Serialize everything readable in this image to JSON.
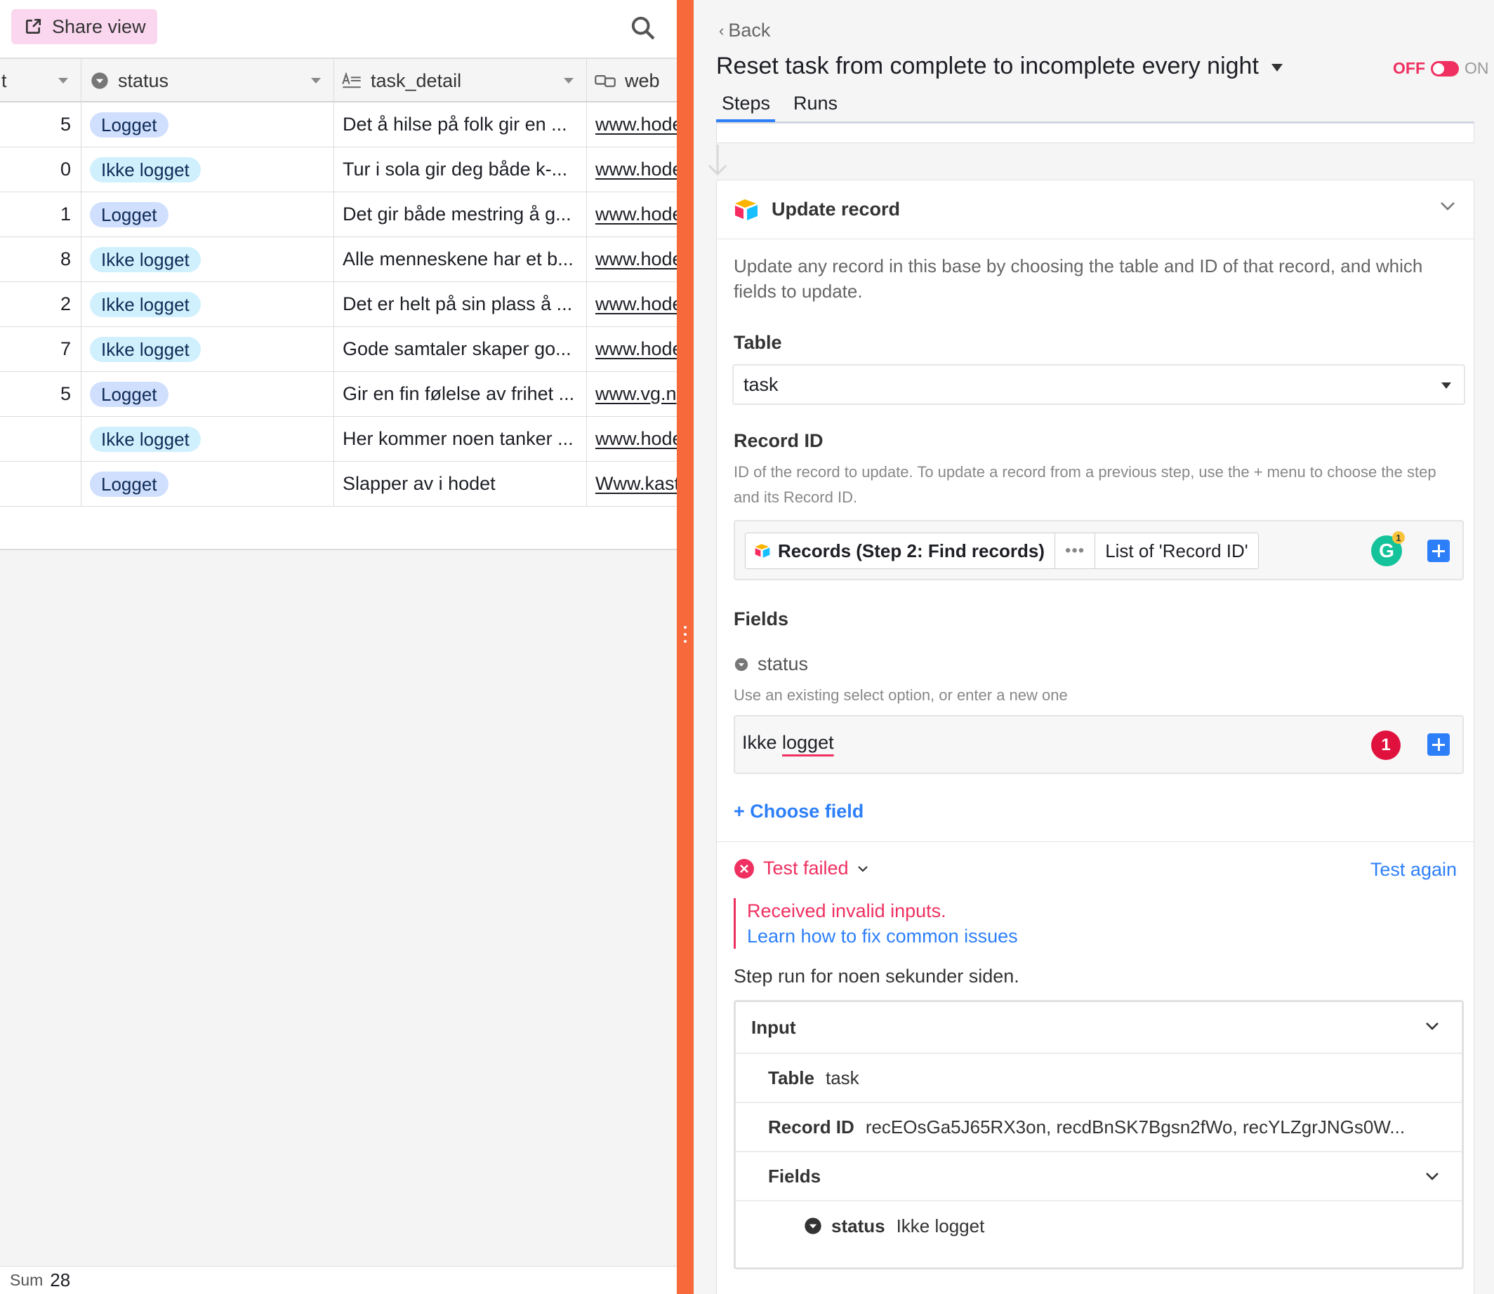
{
  "grid": {
    "share_view_label": "Share view",
    "columns": {
      "num_partial": "t",
      "status": "status",
      "task_detail": "task_detail",
      "web": "web"
    },
    "rows": [
      {
        "num": "5",
        "status": "Logget",
        "status_kind": "logget",
        "detail": "Det å hilse på folk gir en ...",
        "web": "www.hode"
      },
      {
        "num": "0",
        "status": "Ikke logget",
        "status_kind": "ikke",
        "detail": "Tur i sola gir deg både k-...",
        "web": "www.hode"
      },
      {
        "num": "1",
        "status": "Logget",
        "status_kind": "logget",
        "detail": "Det gir både mestring å g...",
        "web": "www.hode"
      },
      {
        "num": "8",
        "status": "Ikke logget",
        "status_kind": "ikke",
        "detail": "Alle menneskene har et b...",
        "web": "www.hode"
      },
      {
        "num": "2",
        "status": "Ikke logget",
        "status_kind": "ikke",
        "detail": "Det er helt på sin plass å ...",
        "web": "www.hode"
      },
      {
        "num": "7",
        "status": "Ikke logget",
        "status_kind": "ikke",
        "detail": "Gode samtaler skaper go...",
        "web": "www.hode"
      },
      {
        "num": "5",
        "status": "Logget",
        "status_kind": "logget",
        "detail": "Gir en fin følelse av frihet ...",
        "web": "www.vg.n"
      },
      {
        "num": "",
        "status": "Ikke logget",
        "status_kind": "ikke",
        "detail": "Her kommer noen tanker ...",
        "web": "www.hode"
      },
      {
        "num": "",
        "status": "Logget",
        "status_kind": "logget",
        "detail": "Slapper av i hodet",
        "web": "Www.kast"
      }
    ],
    "sum_label": "Sum",
    "sum_value": "28"
  },
  "panel": {
    "back_label": "Back",
    "automation_title": "Reset task from complete to incomplete every night",
    "toggle_off": "OFF",
    "toggle_on": "ON",
    "toggle_state": "off",
    "tabs": [
      "Steps",
      "Runs"
    ],
    "active_tab": "Steps",
    "step": {
      "title": "Update record",
      "description": "Update any record in this base by choosing the table and ID of that record, and which fields to update.",
      "table_label": "Table",
      "table_value": "task",
      "record_id_label": "Record ID",
      "record_id_help": "ID of the record to update. To update a record from a previous step, use the + menu to choose the step and its Record ID.",
      "record_token": {
        "source": "Records (Step 2: Find records)",
        "more": "•••",
        "field": "List of 'Record ID'"
      },
      "grammarly_count": "1",
      "fields_label": "Fields",
      "field_name": "status",
      "field_help": "Use an existing select option, or enter a new one",
      "field_value_part1": "Ikke ",
      "field_value_part2": "logget",
      "field_error_count": "1",
      "choose_field": "+ Choose field"
    },
    "test": {
      "status": "Test failed",
      "again": "Test again",
      "error": "Received invalid inputs.",
      "learn_link": "Learn how to fix common issues",
      "run_time": "Step run for noen sekunder siden.",
      "input_label": "Input",
      "table_key": "Table",
      "table_val": "task",
      "record_key": "Record ID",
      "record_val": "recEOsGa5J65RX3on, recdBnSK7Bgsn2fWo, recYLZgrJNGs0W...",
      "fields_key": "Fields",
      "status_key": "status",
      "status_val": "Ikke logget"
    }
  },
  "colors": {
    "divider": "#f7683b",
    "accent_blue": "#2d7ff9",
    "error_red": "#ef3061",
    "share_pink": "#fbd7ef",
    "pill_logget": "#cfdffd",
    "pill_ikke": "#d0f0fd"
  },
  "icons": {
    "share": "share-external-icon",
    "search": "magnifier-icon",
    "status_col": "single-select-icon",
    "detail_col": "long-text-icon",
    "web_col": "url-link-icon",
    "step": "airtable-logo-icon",
    "collapse": "chevron-down-icon",
    "test_failed": "x-circle-icon"
  }
}
